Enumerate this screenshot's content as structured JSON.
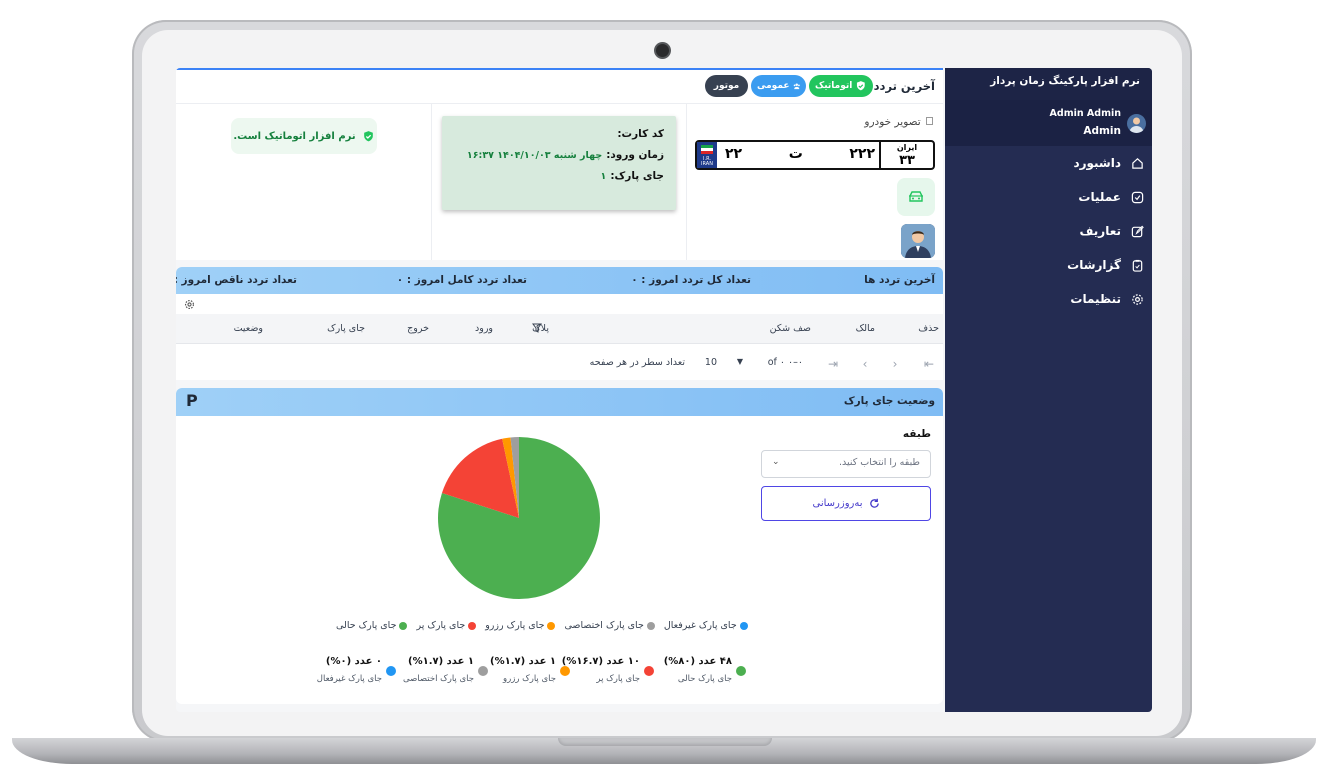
{
  "sidebar": {
    "app_title": "نرم افزار پارکینگ زمان پرداز",
    "user_name": "Admin Admin",
    "user_role": "Admin",
    "items": [
      {
        "label": "داشبورد",
        "icon": "home-icon"
      },
      {
        "label": "عملیات",
        "icon": "check-square-icon"
      },
      {
        "label": "تعاریف",
        "icon": "edit-icon"
      },
      {
        "label": "گزارشات",
        "icon": "clipboard-icon"
      },
      {
        "label": "تنظیمات",
        "icon": "gear-icon"
      }
    ]
  },
  "last_entry": {
    "title": "آخرین تردد",
    "badges": {
      "auto": "اتوماتیک",
      "public": "عمومی",
      "moto": "موتور"
    },
    "car_image_alt": "تصویر خودرو",
    "plate": {
      "part1": "۲۲",
      "letter": "ت",
      "part2": "۲۲۲",
      "iran_label": "ایران",
      "region": "۳۳",
      "country": "I.R.\nIRAN"
    },
    "card_code_label": "کد کارت:",
    "entry_time_label": "زمان ورود:",
    "entry_time_value": "چهار شنبه ۱۴۰۴/۱۰/۰۳ ۱۶:۳۷",
    "parking_spot_label": "جای پارک:",
    "parking_spot_value": "۱",
    "auto_note": "نرم افزار اتوماتیک است."
  },
  "traffic": {
    "title": "آخرین تردد ها",
    "total_today": "تعداد کل تردد امروز : ۰",
    "complete_today": "تعداد تردد کامل امروز : ۰",
    "incomplete_today": "تعداد تردد ناقص امروز : ۰",
    "columns": [
      "حذف",
      "مالک",
      "صف شکن",
      "پلاک",
      "ورود",
      "خروج",
      "جای پارک",
      "وضعیت"
    ],
    "rows_per_page_label": "تعداد سطر در هر صفحه",
    "rows_per_page_value": "10",
    "range_text": "۰–۰ of ۰"
  },
  "parking": {
    "title": "وضعیت جای پارک",
    "badge": "P",
    "floor_label": "طبقه",
    "floor_placeholder": "طبقه را انتخاب کنید.",
    "refresh_label": "به‌روزرسانی"
  },
  "colors": {
    "free": "#4caf50",
    "full": "#f44336",
    "reserved": "#ff9800",
    "private": "#9e9e9e",
    "inactive": "#2196f3",
    "sidebar": "#242c52"
  },
  "chart_data": {
    "type": "pie",
    "categories": [
      "جای پارک حالی",
      "جای پارک پر",
      "جای پارک رزرو",
      "جای پارک اختصاصی",
      "جای پارک غیرفعال"
    ],
    "values": [
      48,
      10,
      1,
      1,
      0
    ],
    "legend": [
      "جای پارک حالی",
      "جای پارک پر",
      "جای پارک رزرو",
      "جای پارک اختصاصی",
      "جای پارک غیرفعال"
    ],
    "legend_position": "bottom",
    "stats": [
      {
        "value": "۴۸ عدد (۸۰%)",
        "label": "جای پارک حالی"
      },
      {
        "value": "۱۰ عدد (۱۶.۷%)",
        "label": "جای پارک پر"
      },
      {
        "value": "۱ عدد (۱.۷%)",
        "label": "جای پارک رزرو"
      },
      {
        "value": "۱ عدد (۱.۷%)",
        "label": "جای پارک اختصاصی"
      },
      {
        "value": "۰ عدد (۰%)",
        "label": "جای پارک غیرفعال"
      }
    ]
  }
}
